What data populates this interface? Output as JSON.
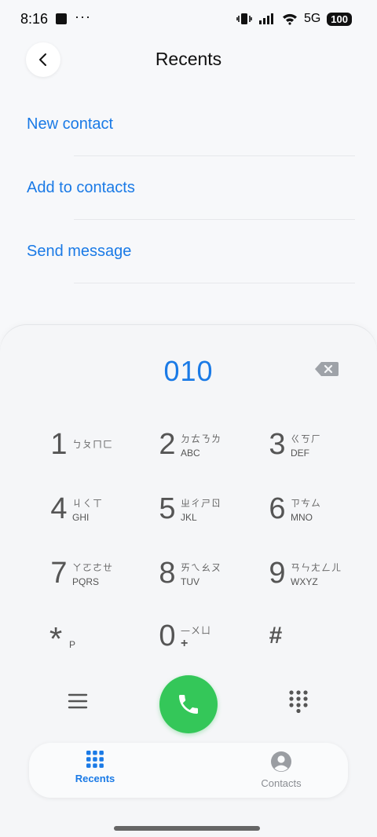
{
  "status_bar": {
    "time": "8:16",
    "dots": "···",
    "network": "5G",
    "battery": "100"
  },
  "header": {
    "title": "Recents"
  },
  "actions": [
    {
      "label": "New contact"
    },
    {
      "label": "Add to contacts"
    },
    {
      "label": "Send message"
    }
  ],
  "dialer": {
    "number": "010",
    "keys": [
      {
        "digit": "1",
        "bopomofo": "ㄅㄆㄇㄈ",
        "letters": ""
      },
      {
        "digit": "2",
        "bopomofo": "ㄉㄊㄋㄌ",
        "letters": "ABC"
      },
      {
        "digit": "3",
        "bopomofo": "ㄍㄎㄏ",
        "letters": "DEF"
      },
      {
        "digit": "4",
        "bopomofo": "ㄐㄑㄒ",
        "letters": "GHI"
      },
      {
        "digit": "5",
        "bopomofo": "ㄓㄔㄕㄖ",
        "letters": "JKL"
      },
      {
        "digit": "6",
        "bopomofo": "ㄗㄘㄙ",
        "letters": "MNO"
      },
      {
        "digit": "7",
        "bopomofo": "ㄚㄛㄜㄝ",
        "letters": "PQRS"
      },
      {
        "digit": "8",
        "bopomofo": "ㄞㄟㄠㄡ",
        "letters": "TUV"
      },
      {
        "digit": "9",
        "bopomofo": "ㄢㄣㄤㄥㄦ",
        "letters": "WXYZ"
      },
      {
        "digit": "*",
        "bopomofo": "",
        "letters": "P"
      },
      {
        "digit": "0",
        "bopomofo": "—ㄨㄩ",
        "letters": "+"
      },
      {
        "digit": "#",
        "bopomofo": "",
        "letters": ""
      }
    ]
  },
  "nav": {
    "recents": "Recents",
    "contacts": "Contacts"
  },
  "colors": {
    "accent": "#1a7ae6",
    "call": "#34c759",
    "inactive": "#8a8d92"
  },
  "icons": [
    "back-icon",
    "backspace-icon",
    "menu-icon",
    "phone-icon",
    "keypad-icon",
    "contacts-icon",
    "vibrate-icon",
    "signal-icon",
    "wifi-icon"
  ]
}
